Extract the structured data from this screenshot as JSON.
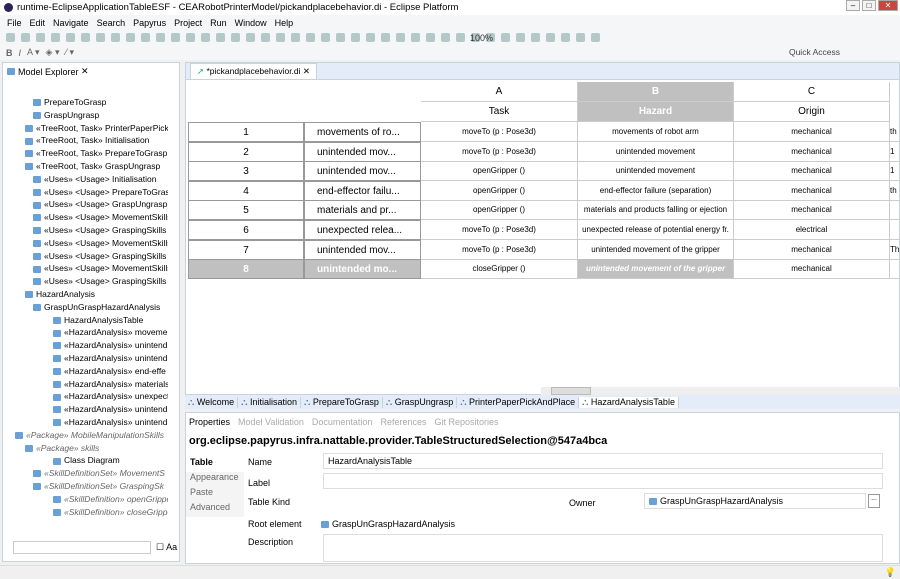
{
  "window": {
    "title": "runtime-EclipseApplicationTableESF - CEARobotPrinterModel/pickandplacebehavior.di - Eclipse Platform"
  },
  "menu": [
    "File",
    "Edit",
    "Navigate",
    "Search",
    "Papyrus",
    "Project",
    "Run",
    "Window",
    "Help"
  ],
  "toolbar": {
    "zoom": "100%",
    "quick_access": "Quick Access"
  },
  "explorer": {
    "title": "Model Explorer",
    "items": [
      "PrepareToGrasp",
      "GraspUngrasp",
      "«TreeRoot, Task» PrinterPaperPick",
      "«TreeRoot, Task» Initialisation",
      "«TreeRoot, Task» PrepareToGrasp",
      "«TreeRoot, Task» GraspUngrasp",
      "«Uses» <Usage> Initialisation",
      "«Uses» <Usage> PrepareToGrasp",
      "«Uses» <Usage> GraspUngrasp",
      "«Uses» <Usage> MovementSkills",
      "«Uses» <Usage> GraspingSkills",
      "«Uses» <Usage> MovementSkills",
      "«Uses» <Usage> GraspingSkills",
      "«Uses» <Usage> MovementSkills",
      "«Uses» <Usage> GraspingSkills",
      "HazardAnalysis",
      "GraspUnGraspHazardAnalysis",
      "HazardAnalysisTable",
      "«HazardAnalysis» moveme",
      "«HazardAnalysis» unintend",
      "«HazardAnalysis» unintend",
      "«HazardAnalysis» end-effe",
      "«HazardAnalysis» materials",
      "«HazardAnalysis» unexpect",
      "«HazardAnalysis» unintend",
      "«HazardAnalysis» unintend",
      "«Package» MobileManipulationSkills",
      "«Package» skills",
      "Class Diagram",
      "«SkillDefinitionSet» MovementS",
      "«SkillDefinitionSet» GraspingSk",
      "«SkillDefinition» openGrippe",
      "«SkillDefinition» closeGrippe"
    ],
    "filter_placeholder": "",
    "case_label": "Aa"
  },
  "editor": {
    "tab": "*pickandplacebehavior.di",
    "col_letters": [
      "A",
      "B",
      "C"
    ],
    "col_headers": [
      "Task",
      "Hazard",
      "Origin"
    ],
    "rows": [
      {
        "n": "1",
        "label": "movements of ro...",
        "task": "moveTo (p : Pose3d)",
        "hazard": "movements of robot arm",
        "origin": "mechanical",
        "d": "th"
      },
      {
        "n": "2",
        "label": "unintended mov...",
        "task": "moveTo (p : Pose3d)",
        "hazard": "unintended movement",
        "origin": "mechanical",
        "d": "1"
      },
      {
        "n": "3",
        "label": "unintended mov...",
        "task": "openGripper ()",
        "hazard": "unintended movement",
        "origin": "mechanical",
        "d": "1"
      },
      {
        "n": "4",
        "label": "end-effector failu...",
        "task": "openGripper ()",
        "hazard": "end-effector failure (separation)",
        "origin": "mechanical",
        "d": "th"
      },
      {
        "n": "5",
        "label": "materials and pr...",
        "task": "openGripper ()",
        "hazard": "materials and products falling or ejection",
        "origin": "mechanical",
        "d": ""
      },
      {
        "n": "6",
        "label": "unexpected relea...",
        "task": "moveTo (p : Pose3d)",
        "hazard": "unexpected release of potential energy fr.",
        "origin": "electrical",
        "d": ""
      },
      {
        "n": "7",
        "label": "unintended mov...",
        "task": "moveTo (p : Pose3d)",
        "hazard": "unintended movement of the gripper",
        "origin": "mechanical",
        "d": "Th"
      },
      {
        "n": "8",
        "label": "unintended mo...",
        "task": "closeGripper ()",
        "hazard": "unintended movement of the gripper",
        "origin": "mechanical",
        "d": ""
      }
    ]
  },
  "editor_tabs": [
    "Welcome",
    "Initialisation",
    "PrepareToGrasp",
    "GraspUngrasp",
    "PrinterPaperPickAndPlace",
    "HazardAnalysisTable"
  ],
  "properties": {
    "tabs": [
      "Properties",
      "Model Validation",
      "Documentation",
      "References",
      "Git Repositories"
    ],
    "selection": "org.eclipse.papyrus.infra.nattable.provider.TableStructuredSelection@547a4bca",
    "sections": [
      "Table",
      "Appearance",
      "Paste",
      "Advanced"
    ],
    "name_label": "Name",
    "name_value": "HazardAnalysisTable",
    "label_label": "Label",
    "table_kind_label": "Table Kind",
    "owner_label": "Owner",
    "owner_value": "GraspUnGraspHazardAnalysis",
    "root_label": "Root element",
    "root_value": "GraspUnGraspHazardAnalysis",
    "description_label": "Description"
  }
}
